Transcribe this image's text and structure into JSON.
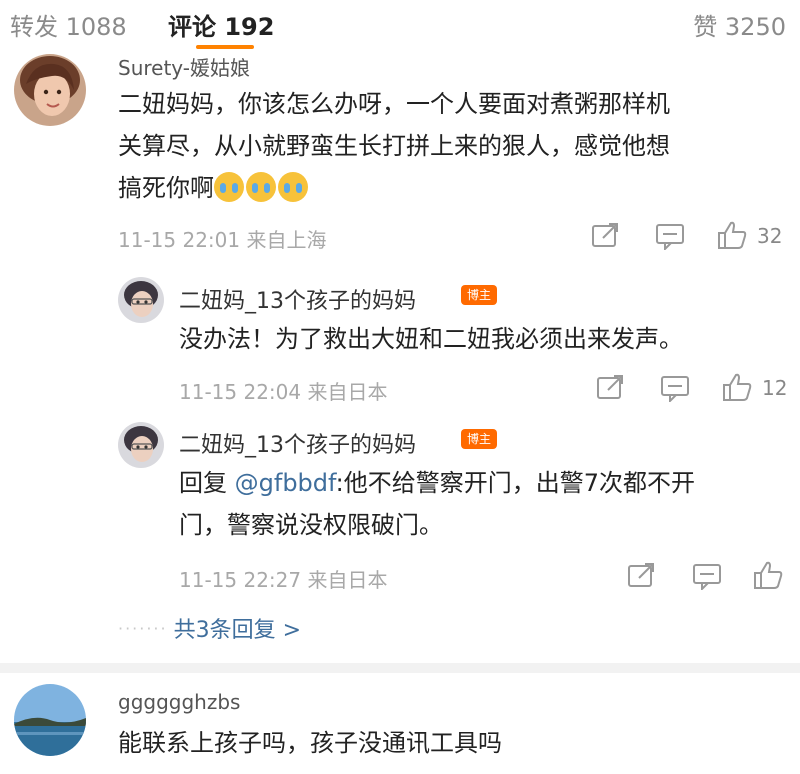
{
  "tabs": {
    "forward": "转发 1088",
    "comments": "评论 192",
    "likes": "赞 3250"
  },
  "comments": [
    {
      "username": "Surety-媛姑娘",
      "text_line1": "二妞妈妈，你该怎么办呀，一个人要面对煮粥那样机",
      "text_line2": "关算尽，从小就野蛮生长打拼上来的狠人，感觉他想",
      "text_line3": "搞死你啊",
      "emoji_count": 3,
      "time": "11-15 22:01 来自上海",
      "like_count": "32",
      "replies": [
        {
          "username": "二妞妈_13个孩子的妈妈",
          "badge": "博主",
          "text": "没办法！为了救出大妞和二妞我必须出来发声。",
          "time": "11-15 22:04 来自日本",
          "like_count": "12"
        },
        {
          "username": "二妞妈_13个孩子的妈妈",
          "badge": "博主",
          "prefix": "回复 ",
          "mention": "@gfbbdf",
          "text_rest": ":他不给警察开门，出警7次都不开",
          "text_line2": "门，警察说没权限破门。",
          "time": "11-15 22:27 来自日本"
        }
      ],
      "more_replies": "共3条回复 >"
    },
    {
      "username": "gggggghzbs",
      "text": "能联系上孩子吗，孩子没通讯工具吗"
    }
  ],
  "colors": {
    "accent": "#ff8200",
    "link": "#3f6e9c",
    "badge": "#ff6a00"
  }
}
